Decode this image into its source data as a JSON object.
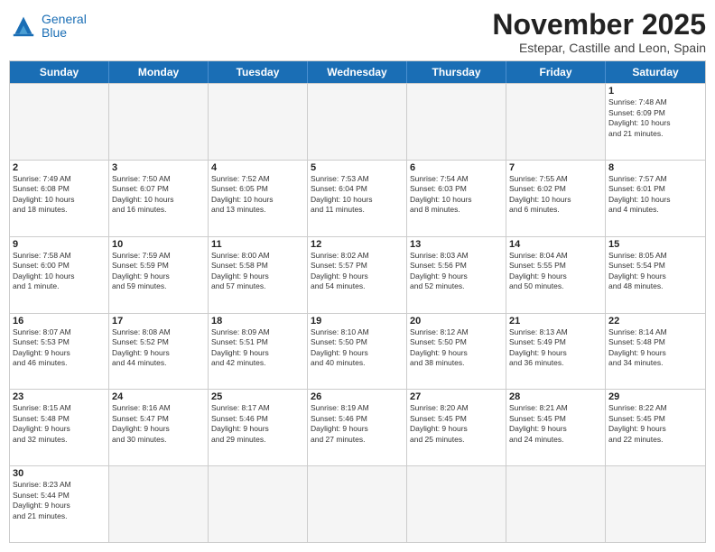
{
  "logo": {
    "line1": "General",
    "line2": "Blue"
  },
  "header": {
    "month": "November 2025",
    "location": "Estepar, Castille and Leon, Spain"
  },
  "weekdays": [
    "Sunday",
    "Monday",
    "Tuesday",
    "Wednesday",
    "Thursday",
    "Friday",
    "Saturday"
  ],
  "rows": [
    [
      {
        "day": "",
        "info": "",
        "empty": true
      },
      {
        "day": "",
        "info": "",
        "empty": true
      },
      {
        "day": "",
        "info": "",
        "empty": true
      },
      {
        "day": "",
        "info": "",
        "empty": true
      },
      {
        "day": "",
        "info": "",
        "empty": true
      },
      {
        "day": "",
        "info": "",
        "empty": true
      },
      {
        "day": "1",
        "info": "Sunrise: 7:48 AM\nSunset: 6:09 PM\nDaylight: 10 hours\nand 21 minutes.",
        "empty": false
      }
    ],
    [
      {
        "day": "2",
        "info": "Sunrise: 7:49 AM\nSunset: 6:08 PM\nDaylight: 10 hours\nand 18 minutes.",
        "empty": false
      },
      {
        "day": "3",
        "info": "Sunrise: 7:50 AM\nSunset: 6:07 PM\nDaylight: 10 hours\nand 16 minutes.",
        "empty": false
      },
      {
        "day": "4",
        "info": "Sunrise: 7:52 AM\nSunset: 6:05 PM\nDaylight: 10 hours\nand 13 minutes.",
        "empty": false
      },
      {
        "day": "5",
        "info": "Sunrise: 7:53 AM\nSunset: 6:04 PM\nDaylight: 10 hours\nand 11 minutes.",
        "empty": false
      },
      {
        "day": "6",
        "info": "Sunrise: 7:54 AM\nSunset: 6:03 PM\nDaylight: 10 hours\nand 8 minutes.",
        "empty": false
      },
      {
        "day": "7",
        "info": "Sunrise: 7:55 AM\nSunset: 6:02 PM\nDaylight: 10 hours\nand 6 minutes.",
        "empty": false
      },
      {
        "day": "8",
        "info": "Sunrise: 7:57 AM\nSunset: 6:01 PM\nDaylight: 10 hours\nand 4 minutes.",
        "empty": false
      }
    ],
    [
      {
        "day": "9",
        "info": "Sunrise: 7:58 AM\nSunset: 6:00 PM\nDaylight: 10 hours\nand 1 minute.",
        "empty": false
      },
      {
        "day": "10",
        "info": "Sunrise: 7:59 AM\nSunset: 5:59 PM\nDaylight: 9 hours\nand 59 minutes.",
        "empty": false
      },
      {
        "day": "11",
        "info": "Sunrise: 8:00 AM\nSunset: 5:58 PM\nDaylight: 9 hours\nand 57 minutes.",
        "empty": false
      },
      {
        "day": "12",
        "info": "Sunrise: 8:02 AM\nSunset: 5:57 PM\nDaylight: 9 hours\nand 54 minutes.",
        "empty": false
      },
      {
        "day": "13",
        "info": "Sunrise: 8:03 AM\nSunset: 5:56 PM\nDaylight: 9 hours\nand 52 minutes.",
        "empty": false
      },
      {
        "day": "14",
        "info": "Sunrise: 8:04 AM\nSunset: 5:55 PM\nDaylight: 9 hours\nand 50 minutes.",
        "empty": false
      },
      {
        "day": "15",
        "info": "Sunrise: 8:05 AM\nSunset: 5:54 PM\nDaylight: 9 hours\nand 48 minutes.",
        "empty": false
      }
    ],
    [
      {
        "day": "16",
        "info": "Sunrise: 8:07 AM\nSunset: 5:53 PM\nDaylight: 9 hours\nand 46 minutes.",
        "empty": false
      },
      {
        "day": "17",
        "info": "Sunrise: 8:08 AM\nSunset: 5:52 PM\nDaylight: 9 hours\nand 44 minutes.",
        "empty": false
      },
      {
        "day": "18",
        "info": "Sunrise: 8:09 AM\nSunset: 5:51 PM\nDaylight: 9 hours\nand 42 minutes.",
        "empty": false
      },
      {
        "day": "19",
        "info": "Sunrise: 8:10 AM\nSunset: 5:50 PM\nDaylight: 9 hours\nand 40 minutes.",
        "empty": false
      },
      {
        "day": "20",
        "info": "Sunrise: 8:12 AM\nSunset: 5:50 PM\nDaylight: 9 hours\nand 38 minutes.",
        "empty": false
      },
      {
        "day": "21",
        "info": "Sunrise: 8:13 AM\nSunset: 5:49 PM\nDaylight: 9 hours\nand 36 minutes.",
        "empty": false
      },
      {
        "day": "22",
        "info": "Sunrise: 8:14 AM\nSunset: 5:48 PM\nDaylight: 9 hours\nand 34 minutes.",
        "empty": false
      }
    ],
    [
      {
        "day": "23",
        "info": "Sunrise: 8:15 AM\nSunset: 5:48 PM\nDaylight: 9 hours\nand 32 minutes.",
        "empty": false
      },
      {
        "day": "24",
        "info": "Sunrise: 8:16 AM\nSunset: 5:47 PM\nDaylight: 9 hours\nand 30 minutes.",
        "empty": false
      },
      {
        "day": "25",
        "info": "Sunrise: 8:17 AM\nSunset: 5:46 PM\nDaylight: 9 hours\nand 29 minutes.",
        "empty": false
      },
      {
        "day": "26",
        "info": "Sunrise: 8:19 AM\nSunset: 5:46 PM\nDaylight: 9 hours\nand 27 minutes.",
        "empty": false
      },
      {
        "day": "27",
        "info": "Sunrise: 8:20 AM\nSunset: 5:45 PM\nDaylight: 9 hours\nand 25 minutes.",
        "empty": false
      },
      {
        "day": "28",
        "info": "Sunrise: 8:21 AM\nSunset: 5:45 PM\nDaylight: 9 hours\nand 24 minutes.",
        "empty": false
      },
      {
        "day": "29",
        "info": "Sunrise: 8:22 AM\nSunset: 5:45 PM\nDaylight: 9 hours\nand 22 minutes.",
        "empty": false
      }
    ],
    [
      {
        "day": "30",
        "info": "Sunrise: 8:23 AM\nSunset: 5:44 PM\nDaylight: 9 hours\nand 21 minutes.",
        "empty": false
      },
      {
        "day": "",
        "info": "",
        "empty": true
      },
      {
        "day": "",
        "info": "",
        "empty": true
      },
      {
        "day": "",
        "info": "",
        "empty": true
      },
      {
        "day": "",
        "info": "",
        "empty": true
      },
      {
        "day": "",
        "info": "",
        "empty": true
      },
      {
        "day": "",
        "info": "",
        "empty": true
      }
    ]
  ]
}
